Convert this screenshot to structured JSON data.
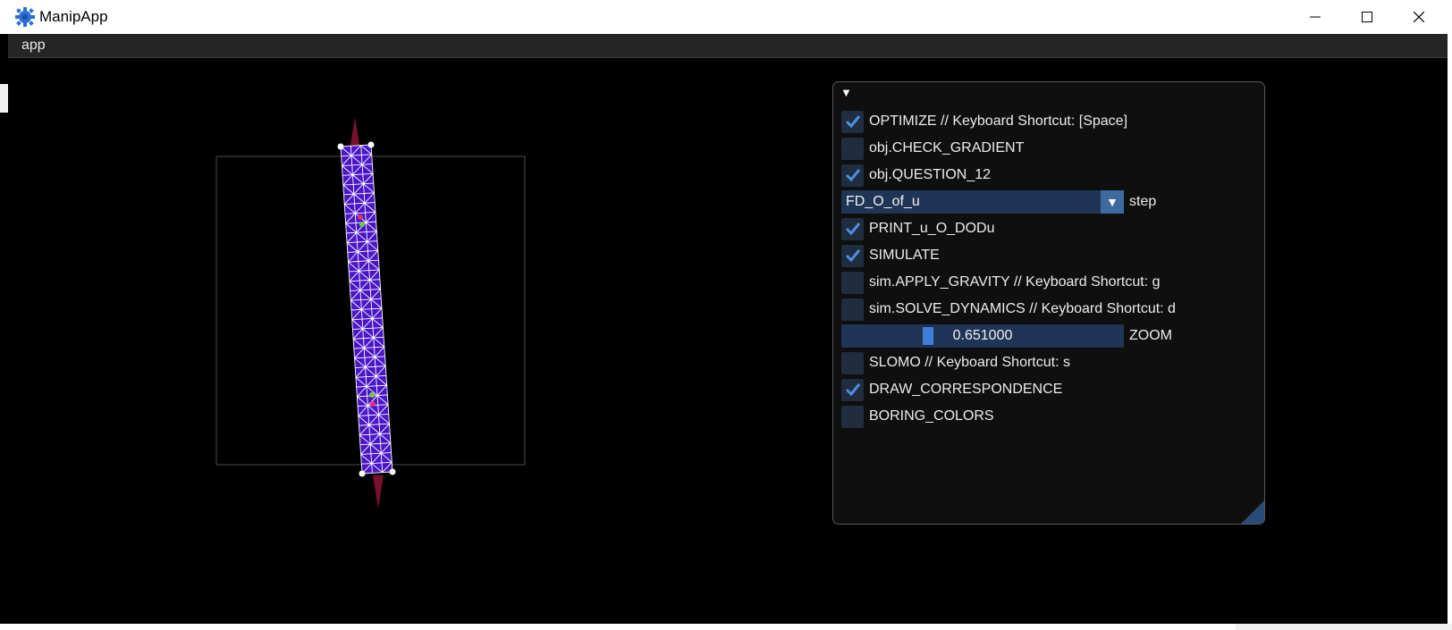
{
  "window": {
    "title": "ManipApp",
    "icons": {
      "app": "gear-icon",
      "minimize": "minimize-icon",
      "maximize": "maximize-icon",
      "close": "close-icon"
    }
  },
  "menubar": {
    "items": [
      {
        "label": "app"
      }
    ]
  },
  "panel": {
    "collapse_icon": "triangle-down-icon",
    "optimize": {
      "label": "OPTIMIZE // Keyboard Shortcut: [Space]",
      "checked": true
    },
    "check_gradient": {
      "label": "obj.CHECK_GRADIENT",
      "checked": false
    },
    "question_12": {
      "label": "obj.QUESTION_12",
      "checked": true
    },
    "step_combo": {
      "value": "FD_O_of_u",
      "label": "step"
    },
    "print_u": {
      "label": "PRINT_u_O_DODu",
      "checked": true
    },
    "simulate": {
      "label": "SIMULATE",
      "checked": true
    },
    "apply_gravity": {
      "label": "sim.APPLY_GRAVITY  // Keyboard Shortcut: g",
      "checked": false
    },
    "solve_dynamics": {
      "label": "sim.SOLVE_DYNAMICS // Keyboard Shortcut: d",
      "checked": false
    },
    "zoom": {
      "value": "0.651000",
      "label": "ZOOM",
      "fraction": 0.3
    },
    "slomo": {
      "label": "SLOMO // Keyboard Shortcut: s",
      "checked": false
    },
    "draw_correspondence": {
      "label": "DRAW_CORRESPONDENCE",
      "checked": true
    },
    "boring_colors": {
      "label": "BORING_COLORS",
      "checked": false
    }
  },
  "colors": {
    "checkbox_bg": "#1f2d3f",
    "check": "#4a90e2",
    "frame": "#1f3555",
    "mesh_fill": "#4a16c8",
    "handle": "#7a1030"
  }
}
